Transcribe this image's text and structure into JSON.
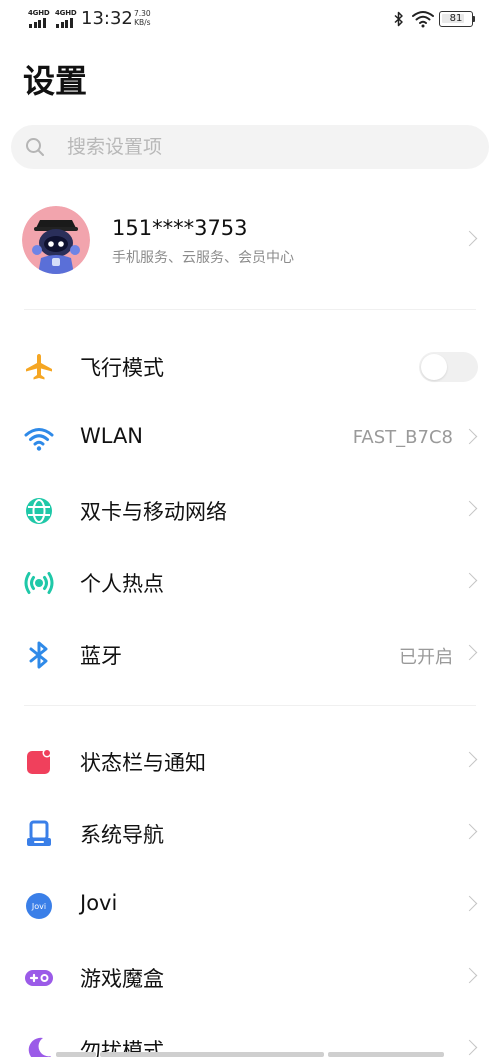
{
  "status_bar": {
    "sim1_label": "4GHD",
    "sim2_label": "4GHD",
    "time": "13:32",
    "speed_value": "7.30",
    "speed_unit": "KB/s",
    "battery": "81",
    "battery_level": 0.81
  },
  "page": {
    "title": "设置"
  },
  "search": {
    "placeholder": "搜索设置项"
  },
  "account": {
    "name": "151****3753",
    "subtitle": "手机服务、云服务、会员中心"
  },
  "settings": {
    "airplane": {
      "label": "飞行模式",
      "icon": "airplane-icon",
      "toggle_on": false
    },
    "wlan": {
      "label": "WLAN",
      "value": "FAST_B7C8",
      "icon": "wifi-icon"
    },
    "sim": {
      "label": "双卡与移动网络",
      "icon": "globe-icon"
    },
    "hotspot": {
      "label": "个人热点",
      "icon": "hotspot-icon"
    },
    "bluetooth": {
      "label": "蓝牙",
      "value": "已开启",
      "icon": "bluetooth-icon"
    },
    "statusbar": {
      "label": "状态栏与通知",
      "icon": "notification-icon"
    },
    "navigation": {
      "label": "系统导航",
      "icon": "system-navigation-icon"
    },
    "jovi": {
      "label": "Jovi",
      "icon": "jovi-icon",
      "icon_text": "Jovi"
    },
    "gamebox": {
      "label": "游戏魔盒",
      "icon": "gamepad-icon"
    },
    "dnd": {
      "label": "勿扰模式",
      "icon": "moon-icon"
    }
  },
  "colors": {
    "airplane": "#f5a623",
    "wifi": "#2f8ae8",
    "teal": "#1fc8a8",
    "bluetooth": "#2f8ae8",
    "notification": "#f0405c",
    "navigation": "#3a7fe8",
    "jovi": "#3a7fe8",
    "gamebox": "#9b5be8",
    "moon": "#9b5be8"
  }
}
